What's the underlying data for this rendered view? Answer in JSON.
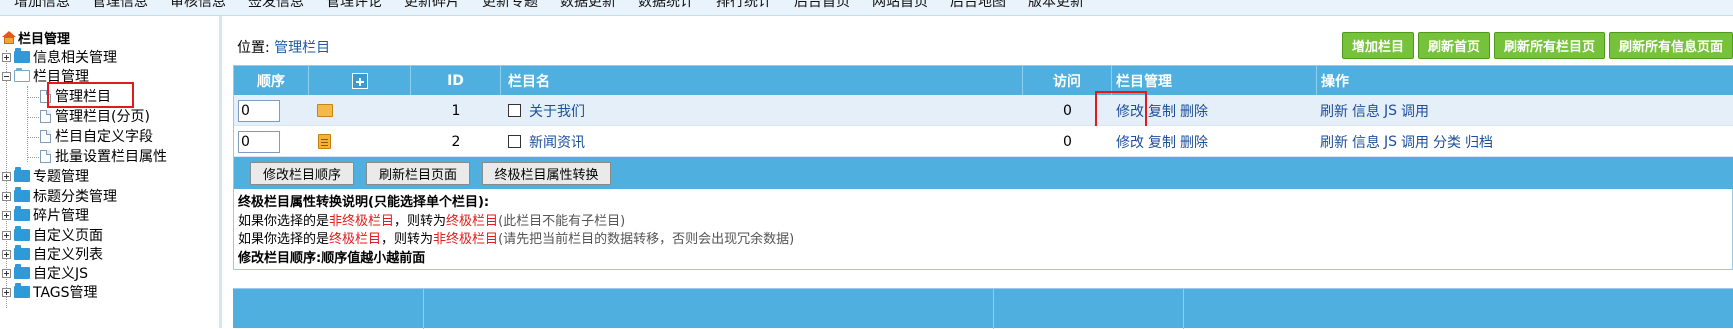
{
  "topnav": {
    "items": [
      "增加信息",
      "管理信息",
      "审核信息",
      "签发信息",
      "管理评论",
      "更新碎片",
      "更新专题",
      "数据更新",
      "数据统计",
      "排行统计",
      "后台首页",
      "网站首页",
      "后台地图",
      "版本更新"
    ]
  },
  "sidebar": {
    "root": "栏目管理",
    "nodes": [
      {
        "label": "信息相关管理"
      },
      {
        "label": "栏目管理"
      },
      {
        "label": "管理栏目"
      },
      {
        "label": "管理栏目(分页)"
      },
      {
        "label": "栏目自定义字段"
      },
      {
        "label": "批量设置栏目属性"
      },
      {
        "label": "专题管理"
      },
      {
        "label": "标题分类管理"
      },
      {
        "label": "碎片管理"
      },
      {
        "label": "自定义页面"
      },
      {
        "label": "自定义列表"
      },
      {
        "label": "自定义JS"
      },
      {
        "label": "TAGS管理"
      }
    ]
  },
  "main": {
    "location_prefix": "位置:",
    "location_link": "管理栏目",
    "buttons": [
      "增加栏目",
      "刷新首页",
      "刷新所有栏目页",
      "刷新所有信息页面"
    ],
    "headers": {
      "order": "顺序",
      "id": "ID",
      "name": "栏目名",
      "visits": "访问",
      "manage": "栏目管理",
      "ops": "操作"
    },
    "rows": [
      {
        "order": "0",
        "id": "1",
        "name": "关于我们",
        "visits": "0",
        "manage": [
          "修改",
          "复制",
          "删除"
        ],
        "ops": [
          "刷新",
          "信息",
          "JS",
          "调用"
        ]
      },
      {
        "order": "0",
        "id": "2",
        "name": "新闻资讯",
        "visits": "0",
        "manage": [
          "修改",
          "复制",
          "删除"
        ],
        "ops": [
          "刷新",
          "信息",
          "JS",
          "调用",
          "分类",
          "归档"
        ]
      }
    ],
    "action_buttons": [
      "修改栏目顺序",
      "刷新栏目页面",
      "终极栏目属性转换"
    ],
    "notes": {
      "title": "终极栏目属性转换说明(只能选择单个栏目):",
      "line1": {
        "a": "如果你选择的是",
        "b": "非终极栏目",
        "c": "，则转为",
        "d": "终极栏目",
        "e": "(此栏目不能有子栏目)"
      },
      "line2": {
        "a": "如果你选择的是",
        "b": "终极栏目",
        "c": "，则转为",
        "d": "非终极栏目",
        "e": "(请先把当前栏目的数据转移，否则会出现冗余数据)"
      },
      "line3": "修改栏目顺序:顺序值越小越前面"
    }
  },
  "colors": {
    "header_blue": "#4fb0df",
    "green_button": "#76c23a",
    "highlight_red": "#e11b1b",
    "link_blue": "#1e4f9a"
  }
}
